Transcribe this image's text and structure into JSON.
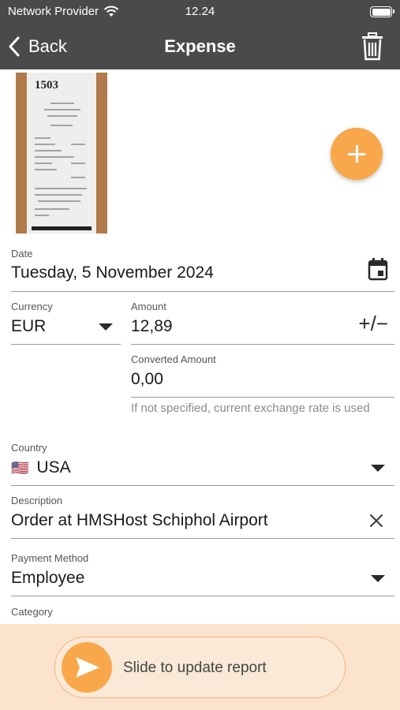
{
  "status_bar": {
    "carrier": "Network Provider",
    "time": "12.24"
  },
  "nav": {
    "back_label": "Back",
    "title": "Expense"
  },
  "receipt": {
    "stamp_text": "1503"
  },
  "form": {
    "date": {
      "label": "Date",
      "value": "Tuesday, 5 November 2024"
    },
    "currency": {
      "label": "Currency",
      "value": "EUR"
    },
    "amount": {
      "label": "Amount",
      "value": "12,89",
      "sign_toggle": "+/−"
    },
    "converted": {
      "label": "Converted Amount",
      "value": "0,00",
      "hint": "If not specified, current exchange rate is used"
    },
    "country": {
      "label": "Country",
      "flag": "🇺🇸",
      "value": "USA"
    },
    "description": {
      "label": "Description",
      "value": "Order at HMSHost Schiphol Airport"
    },
    "payment_method": {
      "label": "Payment Method",
      "value": "Employee"
    },
    "category": {
      "label": "Category"
    }
  },
  "slide": {
    "label": "Slide to update report"
  },
  "colors": {
    "header": "#4a4a4a",
    "accent": "#f8a84a",
    "bottom_bg": "#fbe3cc"
  },
  "icons": [
    "wifi-icon",
    "battery-icon",
    "chevron-left-icon",
    "trash-icon",
    "plus-icon",
    "calendar-icon",
    "dropdown-arrow-icon",
    "plus-minus-icon",
    "clear-icon",
    "send-icon"
  ]
}
